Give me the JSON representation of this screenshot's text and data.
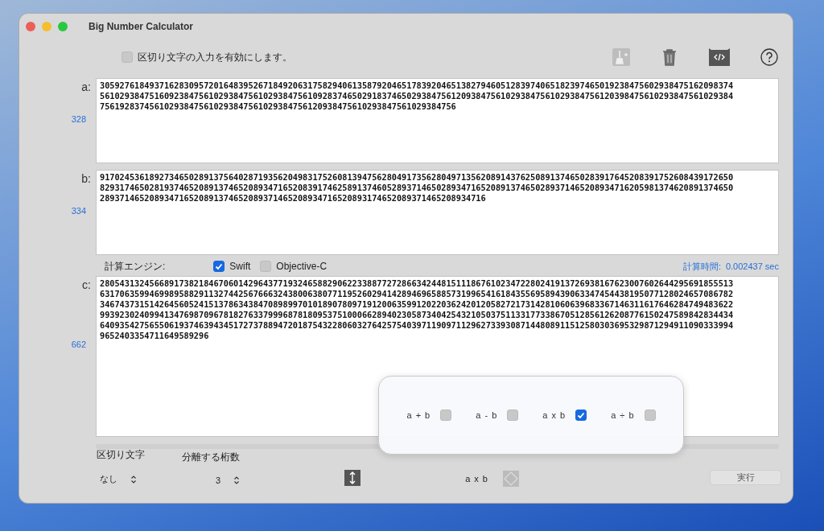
{
  "window": {
    "title": "Big Number Calculator"
  },
  "delimiter_toggle": {
    "label": "区切り文字の入力を有効にします。",
    "checked": false
  },
  "inputs": [
    {
      "label": "a:",
      "digit_count": "328",
      "lines": [
        "30592761849371628309572016483952671849206317582940613587920465178392046513827946051283974065182397465019238475602938475162098374",
        "56102938475160923847561029384756102938475610928374650291837465029384756120938475610293847561029384756120398475610293847561029384",
        "756192837456102938475610293847561029384756120938475610293847561029384756"
      ]
    },
    {
      "label": "b:",
      "digit_count": "334",
      "lines": [
        "91702453618927346502891375640287193562049831752608139475628049173562804971356208914376250891374650283917645208391752608439172650",
        "82931746502819374652089137465208934716520839174625891374605289371465028934716520891374650289371465208934716205981374620891374650",
        "289371465208934716520891374652089371465208934716520893174652089371465208934716"
      ]
    }
  ],
  "engine": {
    "label": "計算エンジン:",
    "options": [
      {
        "label": "Swift",
        "checked": true
      },
      {
        "label": "Objective-C",
        "checked": false
      }
    ]
  },
  "timing": {
    "label": "計算時間:",
    "value": "0.002437 sec"
  },
  "output": {
    "label": "c:",
    "digit_count": "662",
    "lines": [
      "28054313245668917382184670601429643771932465882906223388772728663424481511186761023472280241913726938167623007602644295691855513",
      "63170635994699895882911327442567666324380063807711952602941428946965885731996541618435569589439063347454438195077128024657086782",
      "34674373151426456052415137863438470898997010189078097191200635991202203624201205827217314281060639683367146311617646284749483622",
      "99392302409941347698709678182763379996878180953751000662894023058734042543210503751133177338670512856126208776150247589842834434",
      "64093542756550619374639434517273788947201875432280603276425754039711909711296273393087144808911512580303695329871294911090333994",
      "9652403354711649589296"
    ]
  },
  "operations": [
    {
      "label": "a + b",
      "checked": false
    },
    {
      "label": "a - b",
      "checked": false
    },
    {
      "label": "a x b",
      "checked": true
    },
    {
      "label": "a ÷ b",
      "checked": false
    }
  ],
  "separator": {
    "label": "区切り文字",
    "value": "なし"
  },
  "group_size": {
    "label": "分離する桁数",
    "value": "3"
  },
  "operation_value": "a x b",
  "run_button": "実行"
}
